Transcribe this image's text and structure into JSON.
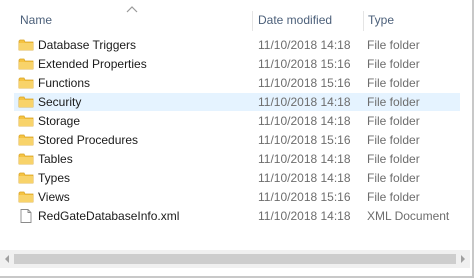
{
  "columns": {
    "name": "Name",
    "date_modified": "Date modified",
    "type": "Type"
  },
  "rows": [
    {
      "name": "Database Triggers",
      "date": "11/10/2018 14:18",
      "type": "File folder",
      "icon": "folder-icon"
    },
    {
      "name": "Extended Properties",
      "date": "11/10/2018 15:16",
      "type": "File folder",
      "icon": "folder-icon"
    },
    {
      "name": "Functions",
      "date": "11/10/2018 15:16",
      "type": "File folder",
      "icon": "folder-icon"
    },
    {
      "name": "Security",
      "date": "11/10/2018 14:18",
      "type": "File folder",
      "icon": "folder-icon"
    },
    {
      "name": "Storage",
      "date": "11/10/2018 14:18",
      "type": "File folder",
      "icon": "folder-icon"
    },
    {
      "name": "Stored Procedures",
      "date": "11/10/2018 15:16",
      "type": "File folder",
      "icon": "folder-icon"
    },
    {
      "name": "Tables",
      "date": "11/10/2018 14:18",
      "type": "File folder",
      "icon": "folder-icon"
    },
    {
      "name": "Types",
      "date": "11/10/2018 14:18",
      "type": "File folder",
      "icon": "folder-icon"
    },
    {
      "name": "Views",
      "date": "11/10/2018 15:16",
      "type": "File folder",
      "icon": "folder-icon"
    },
    {
      "name": "RedGateDatabaseInfo.xml",
      "date": "11/10/2018 14:18",
      "type": "XML Document",
      "icon": "xml-file-icon"
    }
  ],
  "hovered_row_index": 3,
  "colors": {
    "header_text": "#4c607a",
    "hover_bg": "#e5f3ff",
    "folder_yellow": "#f5c342",
    "secondary_text": "#6d6d6d"
  }
}
